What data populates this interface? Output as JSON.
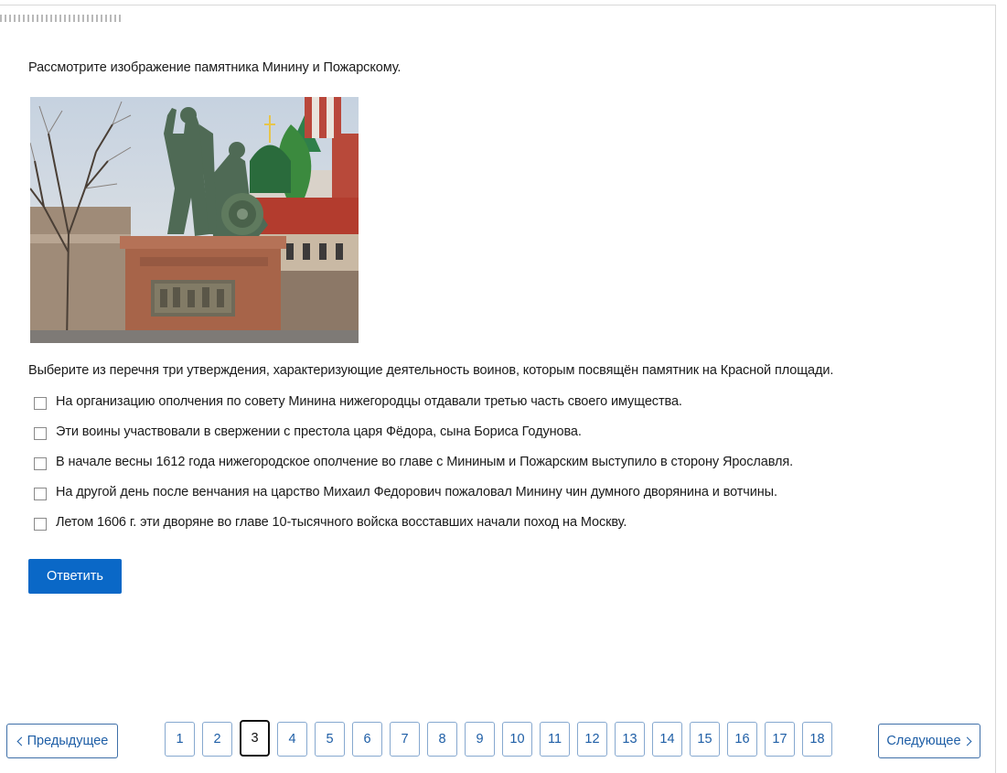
{
  "task": {
    "prompt": "Рассмотрите изображение памятника Минину и Пожарскому.",
    "image_alt": "monument-photo",
    "question": "Выберите из перечня три утверждения, характеризующие деятельность воинов, которым посвящён памятник на Красной площади.",
    "options": [
      {
        "label": "На организацию ополчения по совету Минина нижегородцы отдавали третью часть своего имущества.",
        "checked": false
      },
      {
        "label": "Эти воины участвовали в свержении с престола царя Фёдора, сына Бориса Годунова.",
        "checked": false
      },
      {
        "label": "В начале весны 1612 года нижегородское ополчение во главе с Мининым и Пожарским выступило в сторону Ярославля.",
        "checked": false
      },
      {
        "label": "На другой день после венчания на царство Михаил Федорович пожаловал Минину чин думного дворянина и вотчины.",
        "checked": false
      },
      {
        "label": "Летом 1606 г. эти дворяне во главе 10-тысячного войска восставших начали поход на Москву.",
        "checked": false
      }
    ],
    "submit_label": "Ответить"
  },
  "pagination": {
    "prev_label": "Предыдущее",
    "next_label": "Следующее",
    "pages": [
      "1",
      "2",
      "3",
      "4",
      "5",
      "6",
      "7",
      "8",
      "9",
      "10",
      "11",
      "12",
      "13",
      "14",
      "15",
      "16",
      "17",
      "18"
    ],
    "current": "3"
  },
  "colors": {
    "accent": "#0a68c7",
    "link": "#1e5ea6"
  }
}
